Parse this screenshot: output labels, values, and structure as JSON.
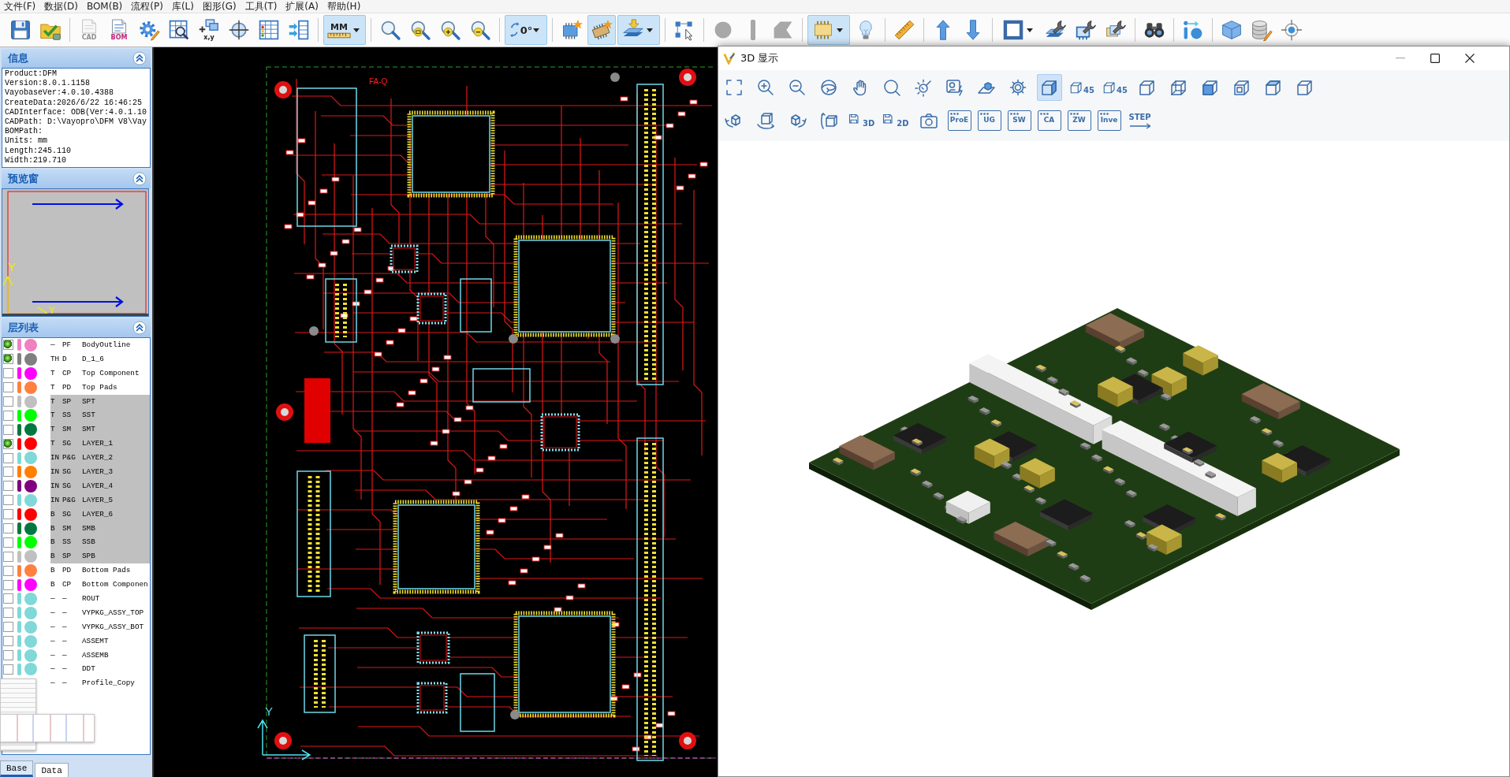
{
  "menu_bar": {
    "items": [
      "文件(F)",
      "数据(D)",
      "BOM(B)",
      "流程(P)",
      "库(L)",
      "图形(G)",
      "工具(T)",
      "扩展(A)",
      "帮助(H)"
    ]
  },
  "toolbar": {
    "items": [
      {
        "kind": "button",
        "selected": false,
        "disabled": false
      },
      {
        "kind": "button",
        "selected": false,
        "disabled": false
      },
      {
        "kind": "separator"
      },
      {
        "kind": "button",
        "label": "CAD",
        "selected": false,
        "disabled": true
      },
      {
        "kind": "button",
        "label": "BOM",
        "selected": false,
        "disabled": false
      },
      {
        "kind": "button",
        "selected": false,
        "disabled": false
      },
      {
        "kind": "button",
        "selected": false,
        "disabled": false
      },
      {
        "kind": "button",
        "label": "x,y",
        "selected": false,
        "disabled": false
      },
      {
        "kind": "button",
        "selected": false,
        "disabled": false
      },
      {
        "kind": "button",
        "selected": false,
        "disabled": false
      },
      {
        "kind": "button",
        "selected": false,
        "disabled": false
      },
      {
        "kind": "separator"
      },
      {
        "kind": "dropdown",
        "label": "MM",
        "selected": true,
        "disabled": false
      },
      {
        "kind": "separator"
      },
      {
        "kind": "button",
        "selected": false,
        "disabled": false
      },
      {
        "kind": "button",
        "selected": false,
        "disabled": false
      },
      {
        "kind": "button",
        "selected": false,
        "disabled": false
      },
      {
        "kind": "button",
        "selected": false,
        "disabled": false
      },
      {
        "kind": "separator"
      },
      {
        "kind": "dropdown",
        "label": "0°",
        "selected": true,
        "disabled": false
      },
      {
        "kind": "separator"
      },
      {
        "kind": "button",
        "selected": false,
        "disabled": false
      },
      {
        "kind": "button",
        "selected": true,
        "disabled": false
      },
      {
        "kind": "dropdown",
        "selected": true,
        "disabled": false
      },
      {
        "kind": "separator"
      },
      {
        "kind": "button",
        "selected": false,
        "disabled": false
      },
      {
        "kind": "separator"
      },
      {
        "kind": "button",
        "selected": false,
        "disabled": true
      },
      {
        "kind": "button",
        "selected": false,
        "disabled": true
      },
      {
        "kind": "button",
        "selected": false,
        "disabled": true
      },
      {
        "kind": "separator"
      },
      {
        "kind": "dropdown",
        "selected": true,
        "disabled": false
      },
      {
        "kind": "button",
        "selected": false,
        "disabled": false
      },
      {
        "kind": "separator"
      },
      {
        "kind": "button",
        "selected": false,
        "disabled": false
      },
      {
        "kind": "separator"
      },
      {
        "kind": "button",
        "selected": false,
        "disabled": false
      },
      {
        "kind": "button",
        "selected": false,
        "disabled": false
      },
      {
        "kind": "separator"
      },
      {
        "kind": "dropdown",
        "selected": false,
        "disabled": false
      },
      {
        "kind": "button",
        "selected": false,
        "disabled": false
      },
      {
        "kind": "button",
        "selected": false,
        "disabled": false
      },
      {
        "kind": "button",
        "selected": false,
        "disabled": false
      },
      {
        "kind": "separator"
      },
      {
        "kind": "button",
        "selected": false,
        "disabled": false
      },
      {
        "kind": "separator"
      },
      {
        "kind": "button",
        "selected": false,
        "disabled": false
      },
      {
        "kind": "separator"
      },
      {
        "kind": "button",
        "selected": false,
        "disabled": false
      },
      {
        "kind": "button",
        "selected": false,
        "disabled": false
      },
      {
        "kind": "button",
        "selected": false,
        "disabled": false
      }
    ]
  },
  "panels": {
    "info": {
      "title": "信息",
      "lines": [
        "Product:DFM",
        "Version:8.0.1.1158",
        "VayobaseVer:4.0.10.4388",
        "CreateData:2026/6/22 16:46:25",
        "CADInterface: ODB(Ver:4.0.1.10",
        "CADPath: D:\\Vayopro\\DFM V8\\Vay",
        "BOMPath:",
        "Units: mm",
        "Length:245.110",
        "Width:219.710"
      ]
    },
    "preview": {
      "title": "预览窗",
      "axis_labels": [
        "Y",
        "Y"
      ]
    },
    "layers": {
      "title": "层列表",
      "rows": [
        {
          "checked": true,
          "color": "#f080c0",
          "side": "—",
          "type": "PF",
          "name": "BodyOutline",
          "selected": false
        },
        {
          "checked": true,
          "color": "#808080",
          "side": "TH",
          "type": "D",
          "name": "D_1_6",
          "selected": false
        },
        {
          "checked": false,
          "color": "#ff00ff",
          "side": "T",
          "type": "CP",
          "name": "Top Component",
          "selected": false
        },
        {
          "checked": false,
          "color": "#ff8040",
          "side": "T",
          "type": "PD",
          "name": "Top Pads",
          "selected": false
        },
        {
          "checked": false,
          "color": "#c0c0c0",
          "side": "T",
          "type": "SP",
          "name": "SPT",
          "selected": true
        },
        {
          "checked": false,
          "color": "#00ff00",
          "side": "T",
          "type": "SS",
          "name": "SST",
          "selected": true
        },
        {
          "checked": false,
          "color": "#007840",
          "side": "T",
          "type": "SM",
          "name": "SMT",
          "selected": true
        },
        {
          "checked": true,
          "color": "#ff0000",
          "side": "T",
          "type": "SG",
          "name": "LAYER_1",
          "selected": true
        },
        {
          "checked": false,
          "color": "#80d8d8",
          "side": "IN",
          "type": "P&G",
          "name": "LAYER_2",
          "selected": true
        },
        {
          "checked": false,
          "color": "#ff8000",
          "side": "IN",
          "type": "SG",
          "name": "LAYER_3",
          "selected": true
        },
        {
          "checked": false,
          "color": "#800080",
          "side": "IN",
          "type": "SG",
          "name": "LAYER_4",
          "selected": true
        },
        {
          "checked": false,
          "color": "#80d8d8",
          "side": "IN",
          "type": "P&G",
          "name": "LAYER_5",
          "selected": true
        },
        {
          "checked": false,
          "color": "#ff0000",
          "side": "B",
          "type": "SG",
          "name": "LAYER_6",
          "selected": true
        },
        {
          "checked": false,
          "color": "#007840",
          "side": "B",
          "type": "SM",
          "name": "SMB",
          "selected": true
        },
        {
          "checked": false,
          "color": "#00ff00",
          "side": "B",
          "type": "SS",
          "name": "SSB",
          "selected": true
        },
        {
          "checked": false,
          "color": "#c0c0c0",
          "side": "B",
          "type": "SP",
          "name": "SPB",
          "selected": true
        },
        {
          "checked": false,
          "color": "#ff8040",
          "side": "B",
          "type": "PD",
          "name": "Bottom Pads",
          "selected": false
        },
        {
          "checked": false,
          "color": "#ff00ff",
          "side": "B",
          "type": "CP",
          "name": "Bottom Componen",
          "selected": false
        },
        {
          "checked": false,
          "color": "#80d8d8",
          "side": "—",
          "type": "—",
          "name": "ROUT",
          "selected": false
        },
        {
          "checked": false,
          "color": "#80d8d8",
          "side": "—",
          "type": "—",
          "name": "VYPKG_ASSY_TOP",
          "selected": false
        },
        {
          "checked": false,
          "color": "#80d8d8",
          "side": "—",
          "type": "—",
          "name": "VYPKG_ASSY_BOT",
          "selected": false
        },
        {
          "checked": false,
          "color": "#80d8d8",
          "side": "—",
          "type": "—",
          "name": "ASSEMT",
          "selected": false
        },
        {
          "checked": false,
          "color": "#80d8d8",
          "side": "—",
          "type": "—",
          "name": "ASSEMB",
          "selected": false
        },
        {
          "checked": false,
          "color": "#80d8d8",
          "side": "—",
          "type": "—",
          "name": "DDT",
          "selected": false
        },
        {
          "side": "—",
          "type": "—",
          "name": "Profile_Copy",
          "selected": false
        }
      ]
    }
  },
  "bottom_tabs": [
    {
      "label": "Base",
      "selected": true
    },
    {
      "label": "Data",
      "selected": false
    }
  ],
  "canvas": {
    "board_label": "FA-Q",
    "axis_label": "Y"
  },
  "viewer_window": {
    "title": "3D 显示",
    "toolbar_rows": [
      [
        {
          "selected": false
        },
        {
          "selected": false
        },
        {
          "selected": false
        },
        {
          "selected": false
        },
        {
          "selected": false
        },
        {
          "selected": false
        },
        {
          "selected": false
        },
        {
          "selected": false
        },
        {
          "selected": false
        },
        {
          "selected": false
        },
        {
          "selected": true
        },
        {
          "label": "45",
          "selected": false
        },
        {
          "label": "45",
          "selected": false
        },
        {
          "selected": false
        },
        {
          "selected": false
        },
        {
          "selected": false
        },
        {
          "selected": false
        },
        {
          "selected": false
        },
        {
          "selected": false
        }
      ],
      [
        {
          "selected": false
        },
        {
          "selected": false
        },
        {
          "selected": false
        },
        {
          "selected": false
        },
        {
          "label": "3D",
          "selected": false
        },
        {
          "label": "2D",
          "selected": false
        },
        {
          "selected": false
        },
        {
          "label": "ProE",
          "selected": false
        },
        {
          "label": "UG",
          "selected": false
        },
        {
          "label": "SW",
          "selected": false
        },
        {
          "label": "CA",
          "selected": false
        },
        {
          "label": "ZW",
          "selected": false
        },
        {
          "label": "Inve",
          "selected": false
        },
        {
          "label": "STEP",
          "selected": false
        }
      ]
    ]
  }
}
